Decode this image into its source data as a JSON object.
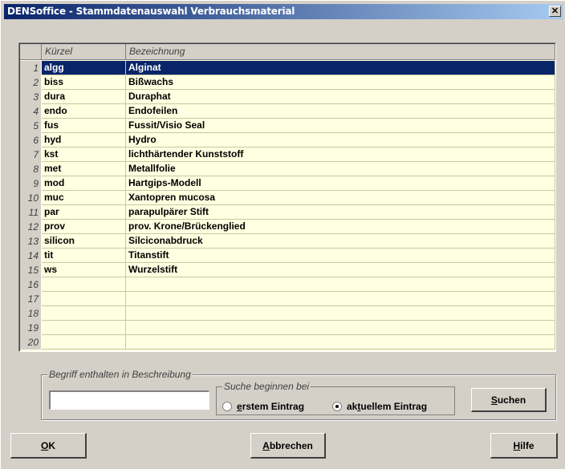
{
  "window": {
    "title": "DENSoffice - Stammdatenauswahl Verbrauchsmaterial",
    "close_glyph": "✕"
  },
  "table": {
    "columns": [
      "Kürzel",
      "Bezeichnung"
    ],
    "rows": [
      {
        "num": "1",
        "kuerzel": "algg",
        "bezeichnung": "Alginat"
      },
      {
        "num": "2",
        "kuerzel": "biss",
        "bezeichnung": "Bißwachs"
      },
      {
        "num": "3",
        "kuerzel": "dura",
        "bezeichnung": "Duraphat"
      },
      {
        "num": "4",
        "kuerzel": "endo",
        "bezeichnung": "Endofeilen"
      },
      {
        "num": "5",
        "kuerzel": "fus",
        "bezeichnung": "Fussit/Visio Seal"
      },
      {
        "num": "6",
        "kuerzel": "hyd",
        "bezeichnung": "Hydro"
      },
      {
        "num": "7",
        "kuerzel": "kst",
        "bezeichnung": "lichthärtender Kunststoff"
      },
      {
        "num": "8",
        "kuerzel": "met",
        "bezeichnung": "Metallfolie"
      },
      {
        "num": "9",
        "kuerzel": "mod",
        "bezeichnung": "Hartgips-Modell"
      },
      {
        "num": "10",
        "kuerzel": "muc",
        "bezeichnung": "Xantopren mucosa"
      },
      {
        "num": "11",
        "kuerzel": "par",
        "bezeichnung": "parapulpärer Stift"
      },
      {
        "num": "12",
        "kuerzel": "prov",
        "bezeichnung": "prov. Krone/Brückenglied"
      },
      {
        "num": "13",
        "kuerzel": "silicon",
        "bezeichnung": "Silciconabdruck"
      },
      {
        "num": "14",
        "kuerzel": "tit",
        "bezeichnung": "Titanstift"
      },
      {
        "num": "15",
        "kuerzel": "ws",
        "bezeichnung": "Wurzelstift"
      },
      {
        "num": "16",
        "kuerzel": "",
        "bezeichnung": ""
      },
      {
        "num": "17",
        "kuerzel": "",
        "bezeichnung": ""
      },
      {
        "num": "18",
        "kuerzel": "",
        "bezeichnung": ""
      },
      {
        "num": "19",
        "kuerzel": "",
        "bezeichnung": ""
      },
      {
        "num": "20",
        "kuerzel": "",
        "bezeichnung": ""
      }
    ],
    "selected_row": 1
  },
  "search": {
    "group_label": "Begriff enthalten in Beschreibung",
    "input_value": "",
    "start_label": "Suche beginnen bei",
    "options": [
      {
        "prefix": "",
        "mnemonic": "e",
        "suffix": "rstem Eintrag",
        "checked": false
      },
      {
        "prefix": "ak",
        "mnemonic": "t",
        "suffix": "uellem Eintrag",
        "checked": true
      }
    ],
    "search_button": {
      "mnemonic": "S",
      "rest": "uchen"
    }
  },
  "buttons": {
    "ok": {
      "mnemonic": "O",
      "rest": "K"
    },
    "cancel": {
      "mnemonic": "A",
      "rest": "bbrechen"
    },
    "help": {
      "mnemonic": "H",
      "rest": "ilfe"
    }
  },
  "colors": {
    "titlebar_start": "#0a246a",
    "titlebar_end": "#a6caf0",
    "grid_background": "#ffffe1",
    "selection": "#0a246a",
    "dialog_face": "#d4d0c8"
  }
}
